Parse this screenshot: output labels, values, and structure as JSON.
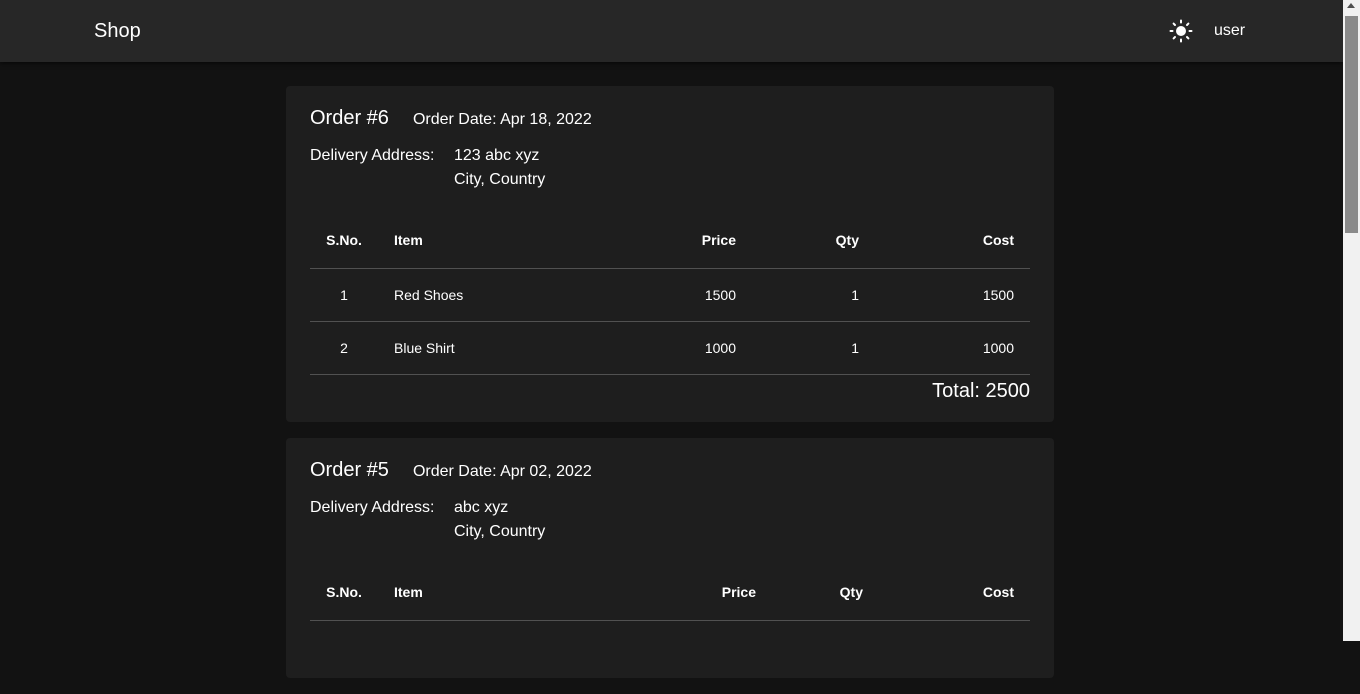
{
  "header": {
    "brand": "Shop",
    "theme_icon": "sun-icon",
    "user": "user"
  },
  "table_headers": {
    "sno": "S.No.",
    "item": "Item",
    "price": "Price",
    "qty": "Qty",
    "cost": "Cost"
  },
  "orders": [
    {
      "title": "Order #6",
      "date": "Order Date: Apr 18, 2022",
      "address_label": "Delivery Address:",
      "address_line1": "123 abc xyz",
      "address_line2": "City, Country",
      "items": [
        {
          "sno": "1",
          "name": "Red Shoes",
          "price": "1500",
          "qty": "1",
          "cost": "1500"
        },
        {
          "sno": "2",
          "name": "Blue Shirt",
          "price": "1000",
          "qty": "1",
          "cost": "1000"
        }
      ],
      "total": "Total: 2500"
    },
    {
      "title": "Order #5",
      "date": "Order Date: Apr 02, 2022",
      "address_label": "Delivery Address:",
      "address_line1": "abc xyz",
      "address_line2": "City, Country",
      "items": []
    }
  ]
}
